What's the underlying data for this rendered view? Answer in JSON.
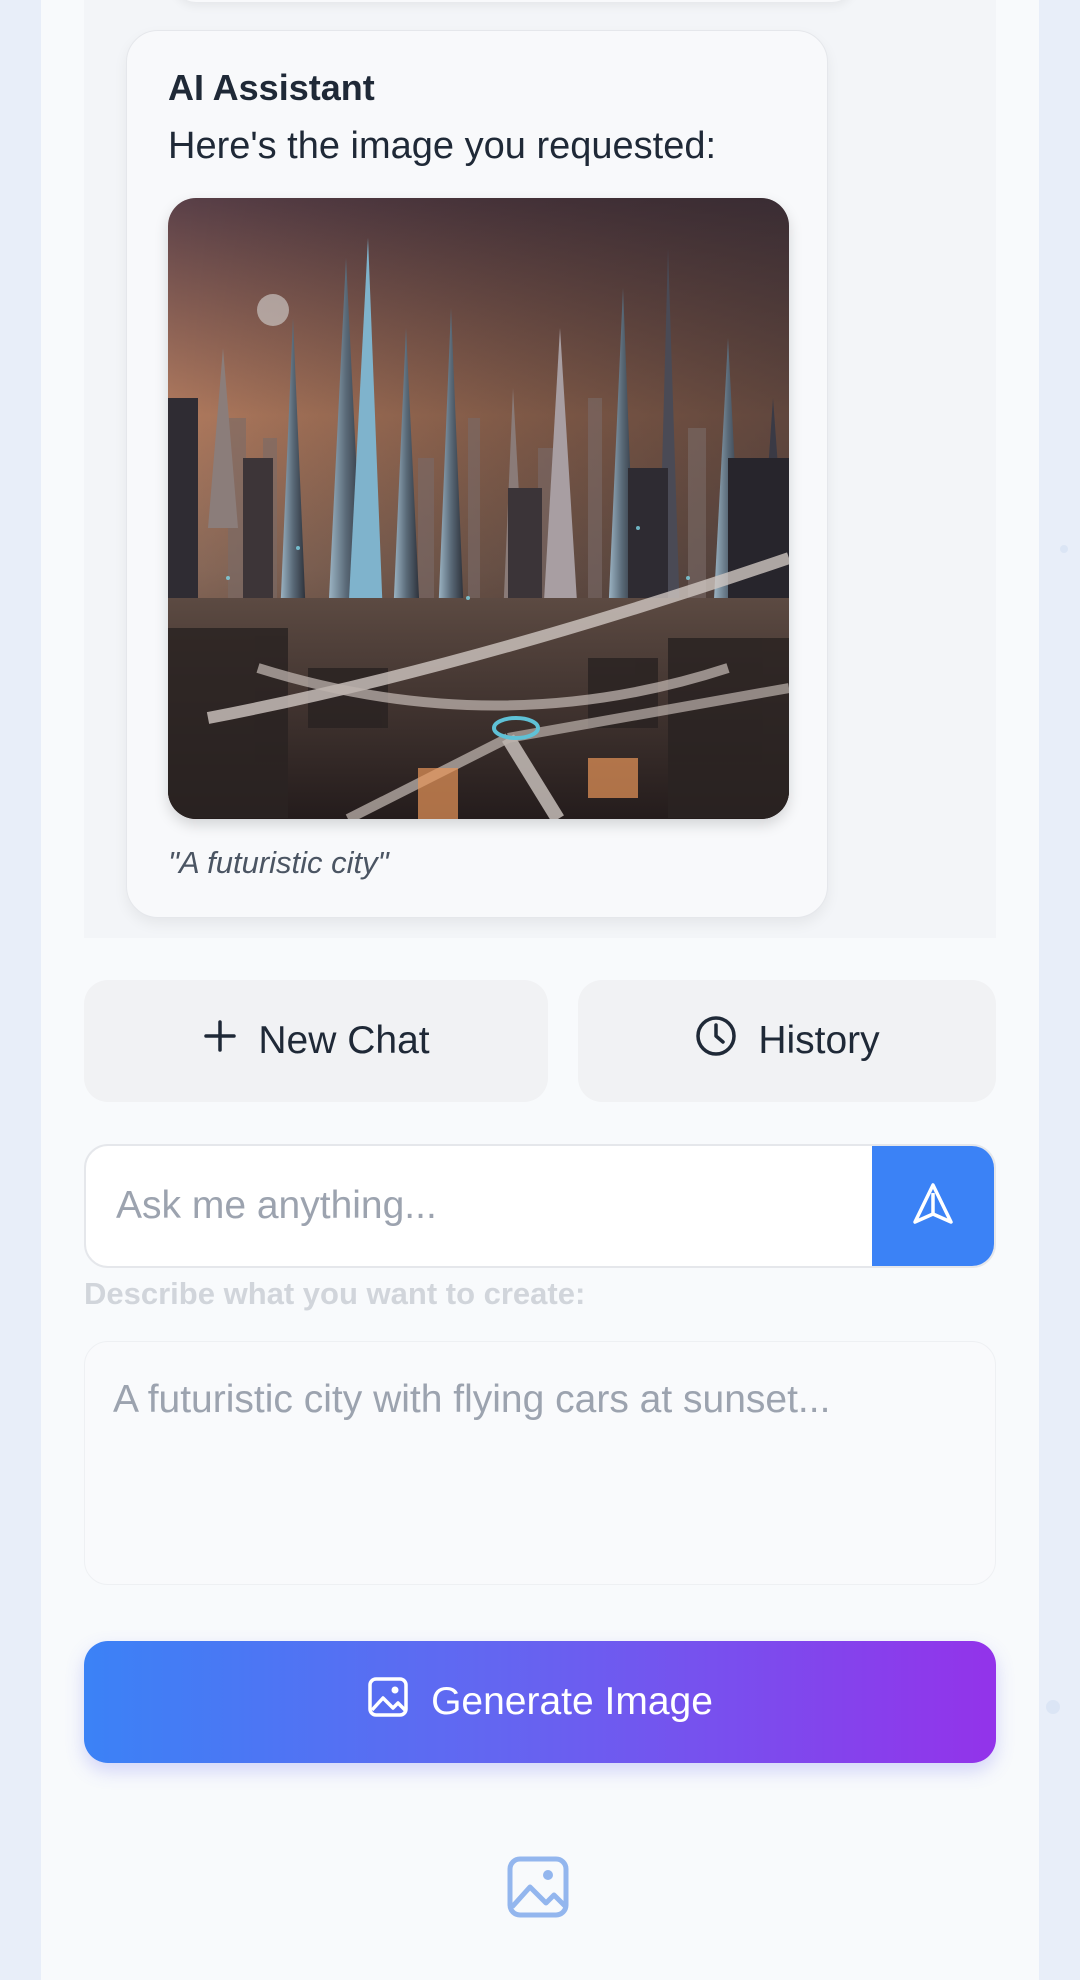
{
  "message": {
    "sender": "AI Assistant",
    "text": "Here's the image you requested:",
    "image_alt": "futuristic city illustration",
    "caption": "\"A futuristic city\""
  },
  "actions": {
    "new_chat_label": "New Chat",
    "history_label": "History"
  },
  "ask": {
    "placeholder": "Ask me anything..."
  },
  "generator": {
    "label": "Describe what you want to create:",
    "placeholder": "A futuristic city with flying cars at sunset...",
    "button_label": "Generate Image"
  },
  "colors": {
    "accent": "#3b82f6",
    "gradient_end": "#9333ea"
  }
}
